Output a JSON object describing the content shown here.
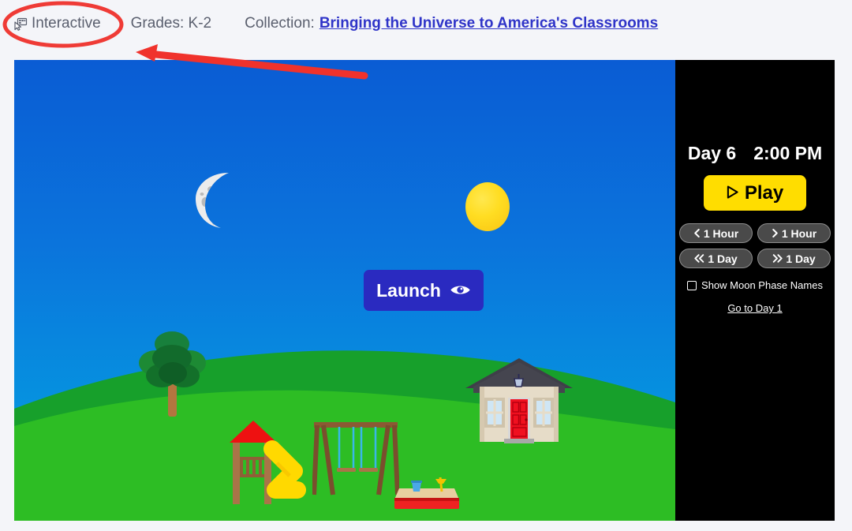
{
  "header": {
    "interactive_icon": "interactive-cursor-icon",
    "interactive_label": "Interactive",
    "grades_label": "Grades: K-2",
    "collection_label": "Collection:",
    "collection_link": "Bringing the Universe to America's Classrooms",
    "link_color": "#2f34c8",
    "text_color": "#5a5f6e"
  },
  "annotation": {
    "ellipse_color": "#ef3b36",
    "arrow_color": "#f0322c",
    "target": "Interactive"
  },
  "scene": {
    "launch_button": {
      "label": "Launch",
      "icon": "eye-icon",
      "color": "#2a2ac0"
    },
    "sky": {
      "top_color": "#0a5cd4",
      "bottom_color": "#04a5e4"
    },
    "sun": {
      "name": "sun",
      "color": "#ffdd22"
    },
    "moon": {
      "name": "moon",
      "phase": "waxing crescent",
      "color": "#e8e8e8"
    },
    "ground": {
      "back_hill_color": "#1aa02a",
      "front_hill_color": "#2fbe23"
    },
    "objects": [
      {
        "name": "tree",
        "leaf_color": "#1f8c2e",
        "trunk_color": "#b3763f"
      },
      {
        "name": "house",
        "wall_color": "#e6dcc8",
        "roof_color": "#40404a",
        "door_color": "#f01020"
      },
      {
        "name": "playset",
        "roof_color": "#ee1111",
        "post_color": "#a97448",
        "slide_color": "#ffd900"
      },
      {
        "name": "swing-set",
        "frame_color": "#8b5a33",
        "chain_color": "#39b7e8"
      },
      {
        "name": "sandbox",
        "box_color": "#ee2222",
        "sand_color": "#e8cfa0",
        "bucket_color": "#4aa8e8"
      }
    ]
  },
  "panel": {
    "background": "#000000",
    "day_label": "Day 6",
    "time_label": "2:00 PM",
    "play_button": {
      "label": "Play",
      "icon": "play-triangle-icon",
      "color": "#ffdd00"
    },
    "step_buttons": [
      {
        "label": "1 Hour",
        "icon": "chevron-left-icon",
        "name": "back-1-hour"
      },
      {
        "label": "1 Hour",
        "icon": "chevron-right-icon",
        "name": "forward-1-hour"
      },
      {
        "label": "1 Day",
        "icon": "chevrons-left-icon",
        "name": "back-1-day"
      },
      {
        "label": "1 Day",
        "icon": "chevrons-right-icon",
        "name": "forward-1-day"
      }
    ],
    "checkbox": {
      "label": "Show Moon Phase Names",
      "checked": false
    },
    "goto_link": "Go to Day 1"
  }
}
